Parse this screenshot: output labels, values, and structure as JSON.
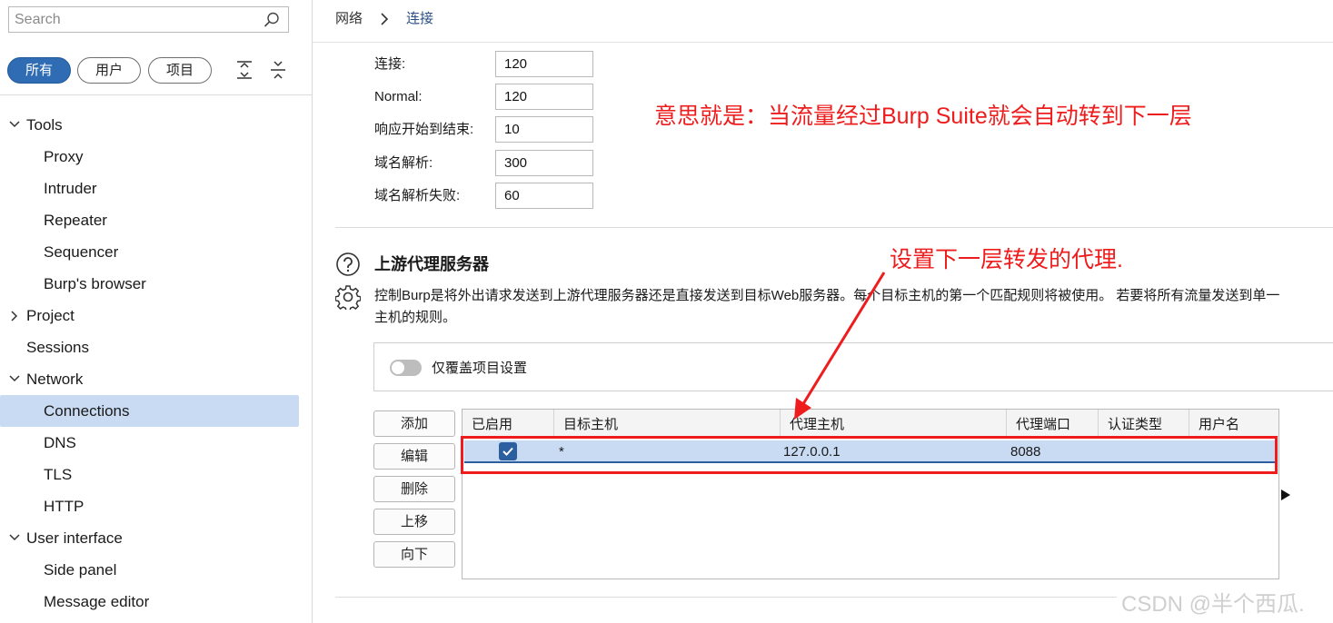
{
  "sidebar": {
    "search_placeholder": "Search",
    "filters": [
      "所有",
      "用户",
      "项目"
    ],
    "tree": [
      {
        "label": "Tools",
        "level": 0,
        "expanded": true
      },
      {
        "label": "Proxy",
        "level": 1
      },
      {
        "label": "Intruder",
        "level": 1
      },
      {
        "label": "Repeater",
        "level": 1
      },
      {
        "label": "Sequencer",
        "level": 1
      },
      {
        "label": "Burp's browser",
        "level": 1
      },
      {
        "label": "Project",
        "level": 0,
        "expanded": false
      },
      {
        "label": "Sessions",
        "level": 0
      },
      {
        "label": "Network",
        "level": 0,
        "expanded": true
      },
      {
        "label": "Connections",
        "level": 1,
        "selected": true
      },
      {
        "label": "DNS",
        "level": 1
      },
      {
        "label": "TLS",
        "level": 1
      },
      {
        "label": "HTTP",
        "level": 1
      },
      {
        "label": "User interface",
        "level": 0,
        "expanded": true
      },
      {
        "label": "Side panel",
        "level": 1
      },
      {
        "label": "Message editor",
        "level": 1
      }
    ]
  },
  "breadcrumb": {
    "parent": "网络",
    "current": "连接"
  },
  "timeouts": [
    {
      "label": "连接:",
      "value": "120"
    },
    {
      "label": "Normal:",
      "value": "120"
    },
    {
      "label": "响应开始到结束:",
      "value": "10"
    },
    {
      "label": "域名解析:",
      "value": "300"
    },
    {
      "label": "域名解析失败:",
      "value": "60"
    }
  ],
  "annotations": {
    "note1": "意思就是：当流量经过Burp Suite就会自动转到下一层",
    "note2": "设置下一层转发的代理."
  },
  "upstream": {
    "title": "上游代理服务器",
    "description_line1": "控制Burp是将外出请求发送到上游代理服务器还是直接发送到目标Web服务器。每个目标主机的第一个匹配规则将被使用。 若要将所有流量发送到单一",
    "description_line2": "主机的规则。",
    "override_label": "仅覆盖项目设置",
    "buttons": [
      "添加",
      "编辑",
      "删除",
      "上移",
      "向下"
    ],
    "columns": [
      "已启用",
      "目标主机",
      "代理主机",
      "代理端口",
      "认证类型",
      "用户名"
    ],
    "rows": [
      {
        "enabled": true,
        "target_host": "*",
        "proxy_host": "127.0.0.1",
        "proxy_port": "8088",
        "auth_type": "",
        "username": ""
      }
    ]
  },
  "watermark": "CSDN @半个西瓜.",
  "colors": {
    "accent": "#2f6cb3",
    "selection": "#c9dbf2",
    "annotation": "#ee1c1c"
  }
}
